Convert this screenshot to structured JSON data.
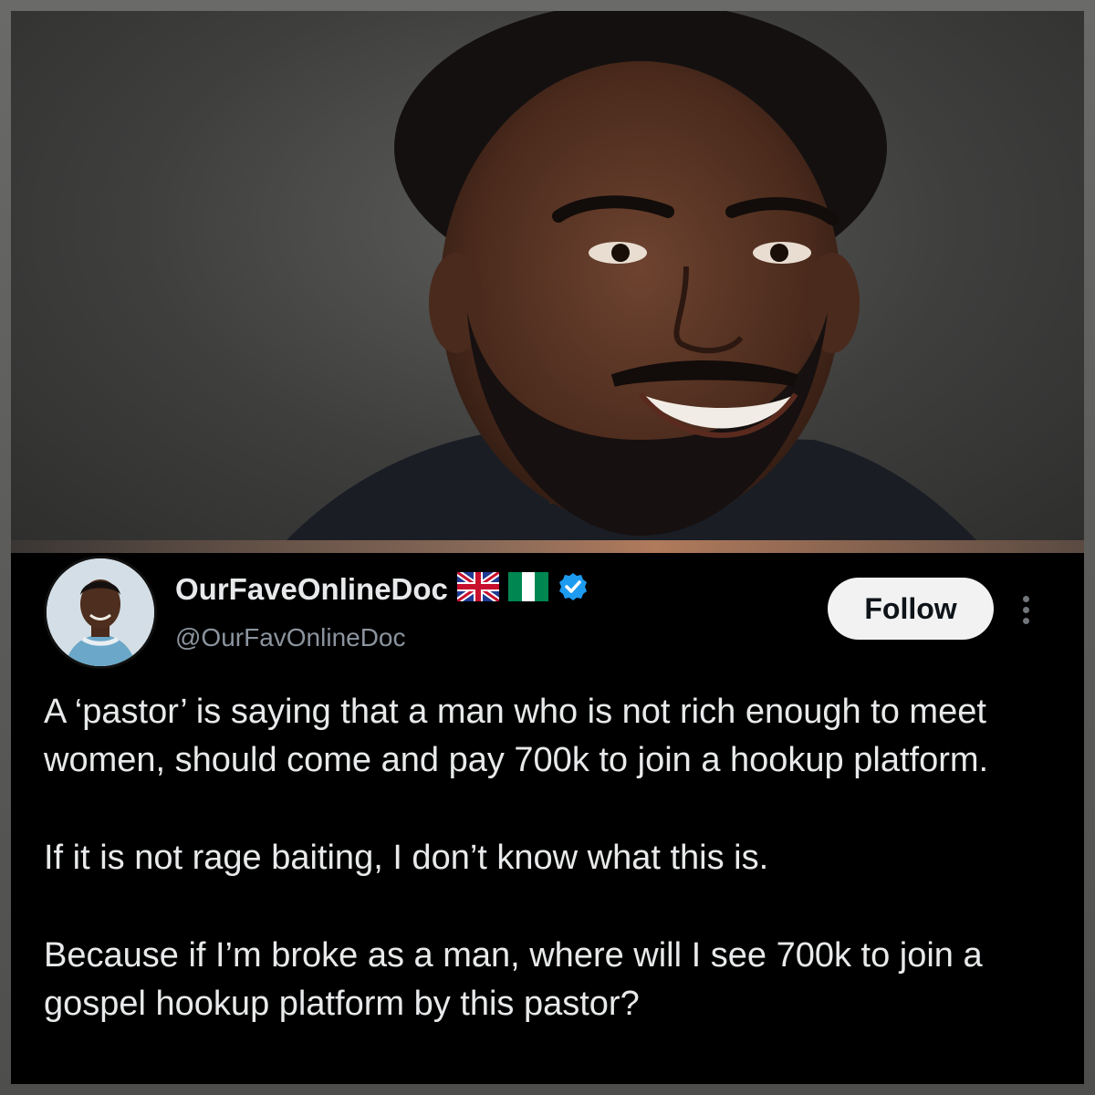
{
  "tweet": {
    "display_name": "OurFaveOnlineDoc",
    "handle": "@OurFavOnlineDoc",
    "badges": [
      "uk-flag-icon",
      "nigeria-flag-icon",
      "verified-badge-icon"
    ],
    "follow_label": "Follow",
    "paragraphs": [
      "A ‘pastor’ is saying that a man who is not rich enough to meet women, should come and pay 700k to join a hookup platform.",
      "If it is not rage baiting, I don’t know what this is.",
      "Because if I’m broke as a man, where will I see 700k to join a gospel hookup platform by this pastor?"
    ]
  },
  "colors": {
    "tweet_background": "#000000",
    "text_primary": "#e7e9ea",
    "text_secondary": "#8b949e",
    "verified_blue": "#1d9bf0",
    "follow_button_bg": "#f2f2f2"
  }
}
